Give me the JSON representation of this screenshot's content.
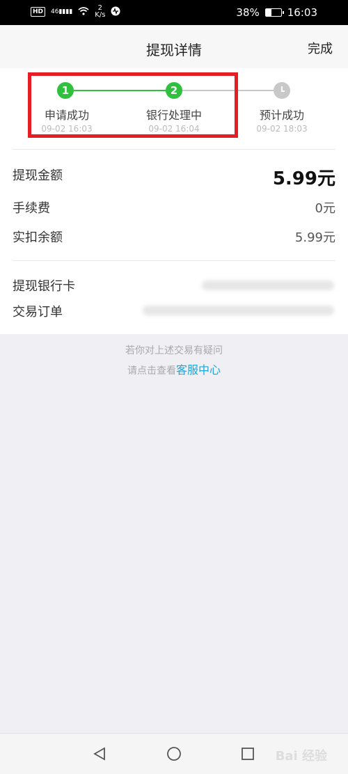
{
  "status_bar": {
    "hd": "HD",
    "signal": "46",
    "speed_value": "2",
    "speed_unit": "K/s",
    "battery": "38%",
    "battery_level": 0.38,
    "time": "16:03"
  },
  "header": {
    "title": "提现详情",
    "done_label": "完成"
  },
  "steps": [
    {
      "number": "1",
      "label": "申请成功",
      "time": "09-02 16:03",
      "status": "done"
    },
    {
      "number": "2",
      "label": "银行处理中",
      "time": "09-02 16:04",
      "status": "current"
    },
    {
      "number": "",
      "label": "预计成功",
      "time": "09-02 18:03",
      "status": "pending"
    }
  ],
  "details": {
    "amount_label": "提现金额",
    "amount_value": "5.99元",
    "fee_label": "手续费",
    "fee_value": "0元",
    "deducted_label": "实扣余额",
    "deducted_value": "5.99元",
    "card_label": "提现银行卡",
    "order_label": "交易订单"
  },
  "help": {
    "line1": "若你对上述交易有疑问",
    "line2_prefix": "请点击查看",
    "link": "客服中心"
  },
  "colors": {
    "green": "#2fc13e",
    "gray": "#c8c8c8",
    "highlight": "#e51d25",
    "link": "#1aa6d9"
  },
  "watermark": "Bai 经验"
}
